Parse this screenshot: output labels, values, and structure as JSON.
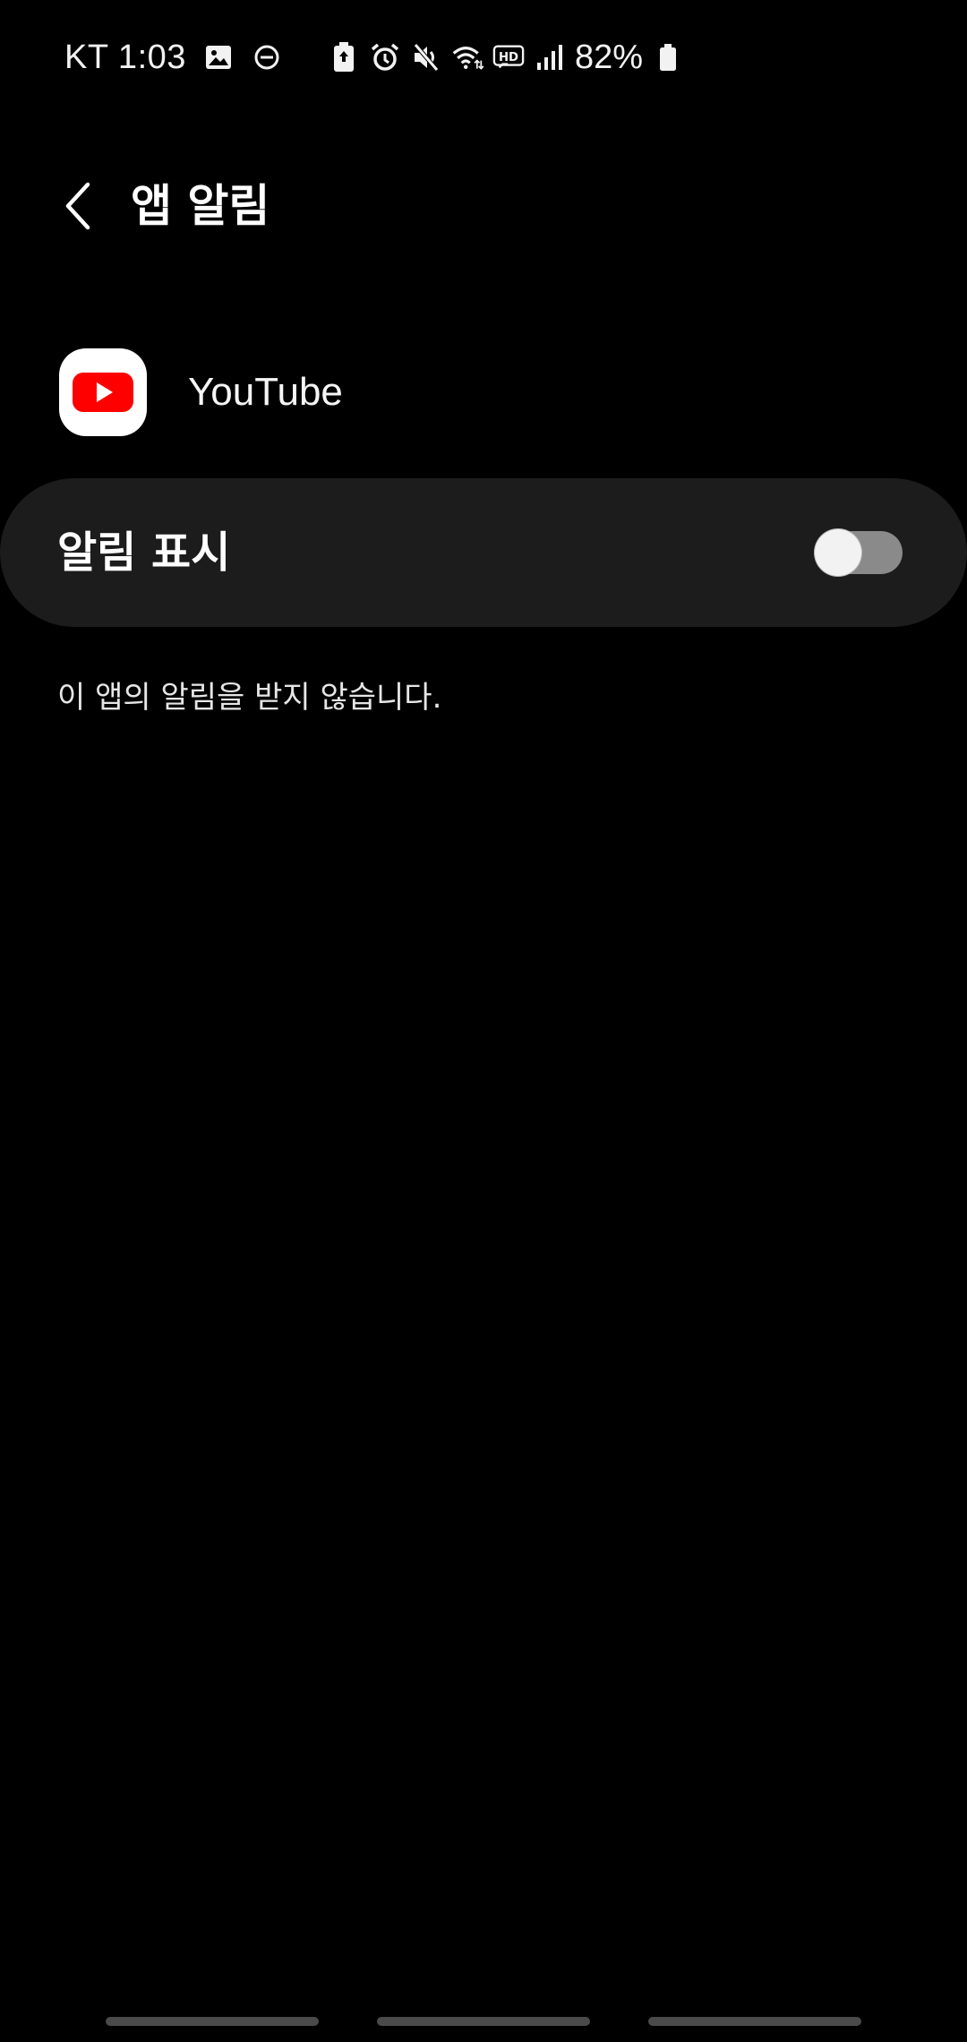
{
  "status_bar": {
    "carrier_time": "KT 1:03",
    "battery_percent": "82%",
    "left_icons": [
      "gallery-icon",
      "dnd-icon"
    ],
    "right_icons": [
      "battery-saver-icon",
      "alarm-icon",
      "mute-icon",
      "wifi-icon",
      "hd-voice-icon",
      "signal-icon",
      "battery-icon"
    ]
  },
  "header": {
    "title": "앱 알림",
    "back_icon": "chevron-left-icon"
  },
  "app": {
    "name": "YouTube",
    "icon": "youtube-icon",
    "brand_color": "#ff0000"
  },
  "setting": {
    "label": "알림 표시",
    "enabled": false
  },
  "description": "이 앱의 알림을 받지 않습니다.",
  "colors": {
    "background": "#000000",
    "card": "#1c1c1c",
    "switch_track_off": "#8a8a8a"
  }
}
